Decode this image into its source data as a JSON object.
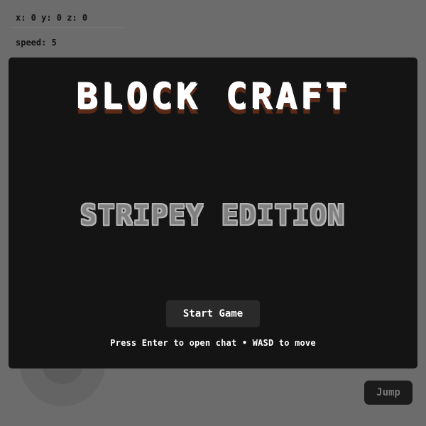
{
  "hud": {
    "coords": "x: 0 y: 0 z: 0",
    "speed": "speed: 5"
  },
  "menu": {
    "title": "BLOCK CRAFT",
    "subtitle": "STRIPEY EDITION",
    "start_label": "Start Game",
    "hint": "Press Enter to open chat • WASD to move"
  },
  "controls": {
    "jump_label": "Jump"
  },
  "colors": {
    "background": "#6c6c6c",
    "panel": "#141414",
    "button": "#2a2a2a",
    "title_shadow": "#5a2a18"
  }
}
